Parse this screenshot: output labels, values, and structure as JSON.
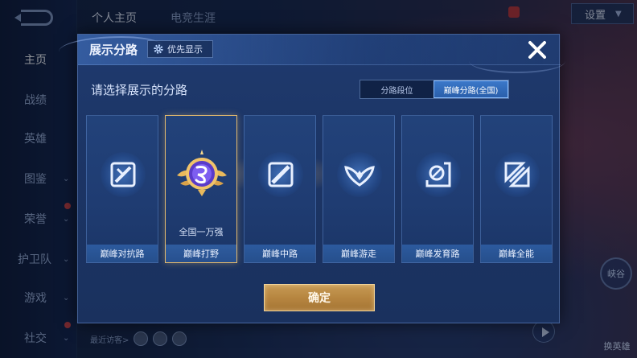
{
  "background": {
    "tabs": [
      "个人主页",
      "电竞生涯"
    ],
    "settings_label": "设置",
    "sidebar": [
      {
        "label": "主页",
        "active": true,
        "chevron": false
      },
      {
        "label": "战绩",
        "active": false,
        "chevron": false
      },
      {
        "label": "英雄",
        "active": false,
        "chevron": false
      },
      {
        "label": "图鉴",
        "active": false,
        "chevron": true
      },
      {
        "label": "荣誉",
        "active": false,
        "chevron": true
      },
      {
        "label": "护卫队",
        "active": false,
        "chevron": true
      },
      {
        "label": "游戏",
        "active": false,
        "chevron": true
      },
      {
        "label": "社交",
        "active": false,
        "chevron": true
      }
    ],
    "visitors_label": "最近访客>",
    "right_label_1": "峡谷",
    "right_label_2": "换英雄"
  },
  "modal": {
    "title": "展示分路",
    "priority_label": "优先显示",
    "subtitle": "请选择展示的分路",
    "segment": {
      "options": [
        "分路段位",
        "巅峰分路(全国)"
      ],
      "selected_index": 1
    },
    "lanes": [
      {
        "name": "巅峰对抗路",
        "icon": "clash-lane-icon",
        "selected": false,
        "rank": ""
      },
      {
        "name": "巅峰打野",
        "icon": "jungle-rank-badge-icon",
        "selected": true,
        "rank": "全国一万强"
      },
      {
        "name": "巅峰中路",
        "icon": "mid-lane-icon",
        "selected": false,
        "rank": ""
      },
      {
        "name": "巅峰游走",
        "icon": "roam-icon",
        "selected": false,
        "rank": ""
      },
      {
        "name": "巅峰发育路",
        "icon": "farm-lane-icon",
        "selected": false,
        "rank": ""
      },
      {
        "name": "巅峰全能",
        "icon": "all-round-icon",
        "selected": false,
        "rank": ""
      }
    ],
    "confirm_label": "确定"
  },
  "colors": {
    "modal_bg": "#1c3566",
    "selected_border": "#e2b96d",
    "segment_active": "#3b78c9",
    "confirm_gold": "#b78640"
  }
}
